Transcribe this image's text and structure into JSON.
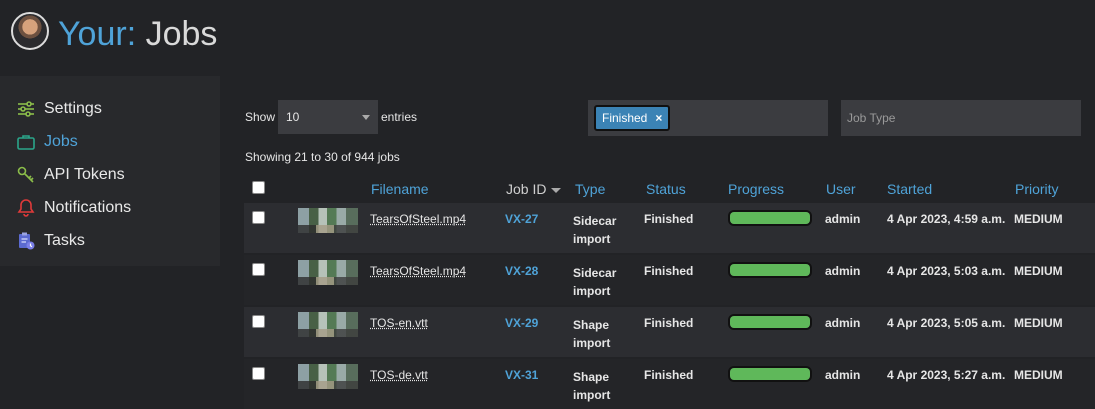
{
  "header": {
    "title_your": "Your",
    "title_colon": ":",
    "title_page": " Jobs"
  },
  "sidebar": {
    "items": [
      {
        "label": "Settings",
        "icon": "sliders-icon",
        "active": false
      },
      {
        "label": "Jobs",
        "icon": "briefcase-icon",
        "active": true
      },
      {
        "label": "API Tokens",
        "icon": "key-icon",
        "active": false
      },
      {
        "label": "Notifications",
        "icon": "bell-icon",
        "active": false
      },
      {
        "label": "Tasks",
        "icon": "clipboard-clock-icon",
        "active": false
      }
    ]
  },
  "controls": {
    "show_label": "Show",
    "page_size": "10",
    "entries_label": "entries",
    "status_chip": "Finished",
    "chip_remove": "×",
    "job_type_placeholder": "Job Type",
    "info": "Showing 21 to 30 of 944 jobs"
  },
  "table": {
    "headers": {
      "filename": "Filename",
      "job_id": "Job ID",
      "type": "Type",
      "status": "Status",
      "progress": "Progress",
      "user": "User",
      "started": "Started",
      "priority": "Priority"
    },
    "rows": [
      {
        "filename": "TearsOfSteel.mp4",
        "job_id": "VX-27",
        "type": "Sidecar import",
        "status": "Finished",
        "progress": 1.0,
        "user": "admin",
        "started": "4 Apr 2023, 4:59 a.m.",
        "priority": "MEDIUM"
      },
      {
        "filename": "TearsOfSteel.mp4",
        "job_id": "VX-28",
        "type": "Sidecar import",
        "status": "Finished",
        "progress": 1.0,
        "user": "admin",
        "started": "4 Apr 2023, 5:03 a.m.",
        "priority": "MEDIUM"
      },
      {
        "filename": "TOS-en.vtt",
        "job_id": "VX-29",
        "type": "Shape import",
        "status": "Finished",
        "progress": 1.0,
        "user": "admin",
        "started": "4 Apr 2023, 5:05 a.m.",
        "priority": "MEDIUM"
      },
      {
        "filename": "TOS-de.vtt",
        "job_id": "VX-31",
        "type": "Shape import",
        "status": "Finished",
        "progress": 1.0,
        "user": "admin",
        "started": "4 Apr 2023, 5:27 a.m.",
        "priority": "MEDIUM"
      }
    ]
  },
  "colors": {
    "accent": "#4fa3d8",
    "progress_fill": "#5fb85a",
    "chip": "#3b83b5"
  }
}
